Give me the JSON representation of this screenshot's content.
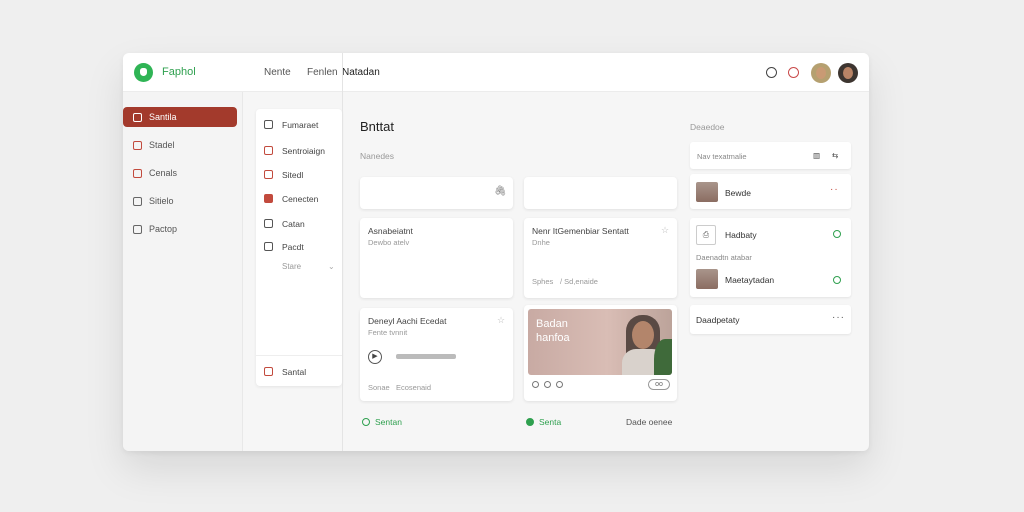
{
  "header": {
    "brand": "Faphol",
    "nav": [
      "Nente",
      "Fenlen",
      "Natadan"
    ]
  },
  "sidebar": {
    "items": [
      {
        "label": "Santila",
        "active": true
      },
      {
        "label": "Stadel"
      },
      {
        "label": "Cenals"
      },
      {
        "label": "Sitielo"
      },
      {
        "label": "Pactop"
      }
    ]
  },
  "subpanel": {
    "items": [
      {
        "label": "Fumaraet"
      },
      {
        "label": "Sentroiaign"
      },
      {
        "label": "Sitedl"
      },
      {
        "label": "Cenecten"
      },
      {
        "label": "Catan"
      },
      {
        "label": "Pacdt"
      }
    ],
    "more": "Stare",
    "footer": "Santal"
  },
  "main": {
    "title": "Bnttat",
    "subtitle": "Nanedes",
    "card1": {
      "title": "Asnabeiatnt",
      "sub": "Dewbo atelv"
    },
    "card2": {
      "title": "Nenr ItGemenbiar Sentatt",
      "sub1": "Dnhe",
      "sub2": "Sphes",
      "sub3": "/ Sd,enaide"
    },
    "card3": {
      "title": "Deneyl Aachi Ecedat",
      "sub1": "Fente tvnnit",
      "sub2": "Sonae",
      "sub3": "Ecosenaid"
    },
    "card4": {
      "photo_title1": "Badan",
      "photo_title2": "hanfoa",
      "pill": "oo"
    },
    "link1": "Sentan",
    "link2": "Senta",
    "link3": "Dade oenee"
  },
  "right": {
    "heading": "Deaedoe",
    "filter_label": "Nav texatmalie",
    "row1": "Bewde",
    "row2_title": "Hadbaty",
    "row2_sub": "Daenadtn atabar",
    "row3": "Maetaytadan",
    "row4": "Daadpetaty"
  }
}
